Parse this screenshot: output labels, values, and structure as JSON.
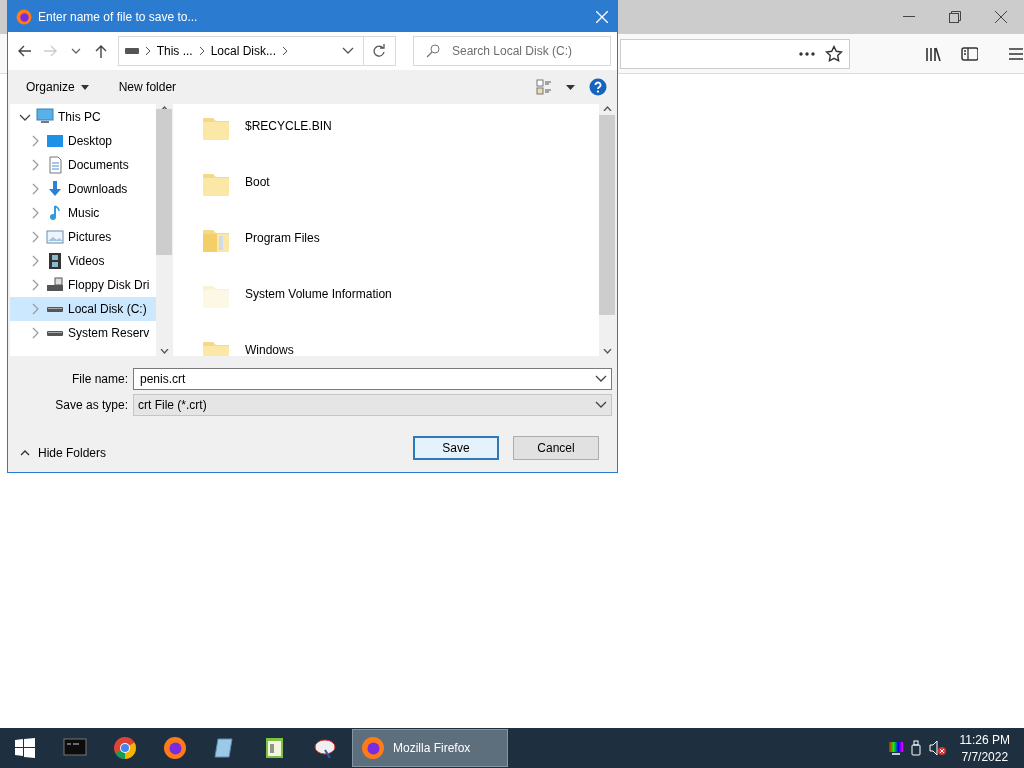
{
  "dialog": {
    "title": "Enter name of file to save to...",
    "breadcrumb": [
      "This ...",
      "Local Disk..."
    ],
    "search": {
      "placeholder": "Search Local Disk (C:)"
    },
    "toolbar": {
      "organize": "Organize",
      "new_folder": "New folder"
    },
    "tree": [
      {
        "label": "This PC",
        "kind": "pc",
        "expanded": true,
        "selected": false,
        "children": [
          {
            "label": "Desktop",
            "kind": "desktop",
            "expanded": false,
            "selected": false
          },
          {
            "label": "Documents",
            "kind": "documents",
            "expanded": false,
            "selected": false
          },
          {
            "label": "Downloads",
            "kind": "downloads",
            "expanded": false,
            "selected": false
          },
          {
            "label": "Music",
            "kind": "music",
            "expanded": false,
            "selected": false
          },
          {
            "label": "Pictures",
            "kind": "pictures",
            "expanded": false,
            "selected": false
          },
          {
            "label": "Videos",
            "kind": "videos",
            "expanded": false,
            "selected": false
          },
          {
            "label": "Floppy Disk Dri",
            "kind": "floppy",
            "expanded": false,
            "selected": false
          },
          {
            "label": "Local Disk (C:)",
            "kind": "drive",
            "expanded": false,
            "selected": true
          },
          {
            "label": "System Reserv",
            "kind": "drive",
            "expanded": false,
            "selected": false
          }
        ]
      }
    ],
    "files": [
      {
        "name": "$RECYCLE.BIN",
        "kind": "folder"
      },
      {
        "name": "Boot",
        "kind": "folder"
      },
      {
        "name": "Program Files",
        "kind": "folder-full"
      },
      {
        "name": "System Volume Information",
        "kind": "folder-faded"
      },
      {
        "name": "Windows",
        "kind": "folder"
      }
    ],
    "file_name": {
      "label": "File name:",
      "value": "penis.crt"
    },
    "save_as_type": {
      "label": "Save as type:",
      "value": "crt File (*.crt)"
    },
    "hide_folders": "Hide Folders",
    "buttons": [
      {
        "label": "Save",
        "kind": "default"
      },
      {
        "label": "Cancel",
        "kind": "normal"
      }
    ]
  },
  "taskbar": {
    "apps": [
      {
        "kind": "terminal"
      },
      {
        "kind": "chrome"
      },
      {
        "kind": "firefox"
      },
      {
        "kind": "notepad"
      },
      {
        "kind": "editor"
      },
      {
        "kind": "paint"
      }
    ],
    "window": {
      "label": "Mozilla Firefox"
    },
    "time": "11:26 PM",
    "date": "7/7/2022"
  }
}
